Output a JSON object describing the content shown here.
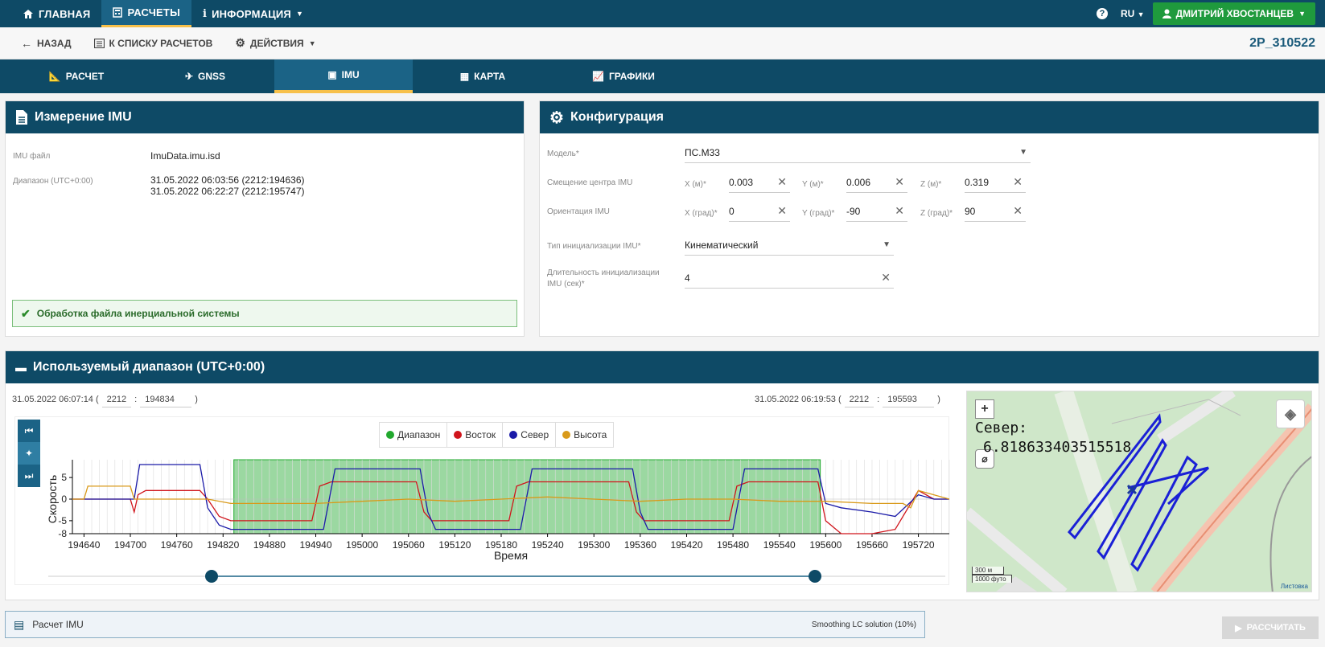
{
  "topnav": {
    "home_label": "ГЛАВНАЯ",
    "calc_label": "РАСЧЕТЫ",
    "info_label": "ИНФОРМАЦИЯ",
    "lang": "RU",
    "user": "ДМИТРИЙ ХВОСТАНЦЕВ"
  },
  "actions": {
    "back": "НАЗАД",
    "to_list": "К СПИСКУ РАСЧЕТОВ",
    "actions": "ДЕЙСТВИЯ",
    "code": "2P_310522"
  },
  "tabs": [
    {
      "label": "РАСЧЕТ"
    },
    {
      "label": "GNSS"
    },
    {
      "label": "IMU"
    },
    {
      "label": "КАРТА"
    },
    {
      "label": "ГРАФИКИ"
    }
  ],
  "imu_panel": {
    "title": "Измерение IMU",
    "file_label": "IMU файл",
    "file_value": "ImuData.imu.isd",
    "range_label": "Диапазон (UTC+0:00)",
    "range_start": "31.05.2022 06:03:56 (2212:194636)",
    "range_end": "31.05.2022 06:22:27 (2212:195747)",
    "success": "Обработка файла инерциальной системы"
  },
  "config_panel": {
    "title": "Конфигурация",
    "model_label": "Модель*",
    "model_value": "ПС.М33",
    "offset_label": "Смещение центра IMU",
    "offset_x_label": "X (м)*",
    "offset_x": "0.003",
    "offset_y_label": "Y (м)*",
    "offset_y": "0.006",
    "offset_z_label": "Z (м)*",
    "offset_z": "0.319",
    "orient_label": "Ориентация IMU",
    "orient_x_label": "X (град)*",
    "orient_x": "0",
    "orient_y_label": "Y (град)*",
    "orient_y": "-90",
    "orient_z_label": "Z (град)*",
    "orient_z": "90",
    "init_type_label": "Тип инициализации IMU*",
    "init_type_value": "Кинематический",
    "init_dur_label_1": "Длительность инициализации",
    "init_dur_label_2": "IMU (сек)*",
    "init_dur_value": "4"
  },
  "range_panel": {
    "title": "Используемый диапазон (UTC+0:00)",
    "start_time": "31.05.2022 06:07:14 (",
    "start_week": "2212",
    "start_sep": ":",
    "start_sec": "194834",
    "start_close": ")",
    "end_time": "31.05.2022 06:19:53 (",
    "end_week": "2212",
    "end_sep": ":",
    "end_sec": "195593",
    "end_close": ")"
  },
  "chart_data": {
    "type": "line",
    "xlabel": "Время",
    "ylabel": "Скорость",
    "xlim": [
      194625,
      195760
    ],
    "ylim": [
      -8,
      8
    ],
    "x_ticks": [
      194640,
      194700,
      194760,
      194820,
      194880,
      194940,
      195000,
      195060,
      195120,
      195180,
      195240,
      195300,
      195360,
      195420,
      195480,
      195540,
      195600,
      195660,
      195720
    ],
    "y_ticks": [
      -8,
      -5,
      0,
      5
    ],
    "legend": [
      "Диапазон",
      "Восток",
      "Север",
      "Высота"
    ],
    "range": [
      194834,
      195593
    ],
    "colors": {
      "range": "#22a82e",
      "east": "#d0141b",
      "north": "#1a1aa8",
      "height": "#d99a1a"
    },
    "series": [
      {
        "name": "Восток",
        "x": [
          194625,
          194700,
          194705,
          194710,
          194720,
          194730,
          194740,
          194790,
          194800,
          194815,
          194830,
          194845,
          194935,
          194945,
          194960,
          195070,
          195080,
          195090,
          195190,
          195200,
          195215,
          195345,
          195355,
          195365,
          195475,
          195485,
          195500,
          195590,
          195600,
          195620,
          195660,
          195690,
          195720,
          195740,
          195760
        ],
        "values": [
          0,
          0,
          -3,
          1,
          2,
          2,
          2,
          2,
          0,
          -4,
          -5,
          -5,
          -5,
          3,
          4,
          4,
          -3,
          -5,
          -5,
          3,
          4,
          4,
          -3,
          -5,
          -5,
          3,
          4,
          4,
          -5,
          -8,
          -8,
          -7,
          2,
          0,
          0
        ]
      },
      {
        "name": "Север",
        "x": [
          194625,
          194700,
          194705,
          194712,
          194720,
          194730,
          194790,
          194800,
          194815,
          194830,
          194950,
          194965,
          195075,
          195085,
          195095,
          195205,
          195220,
          195350,
          195360,
          195370,
          195480,
          195495,
          195590,
          195600,
          195620,
          195660,
          195690,
          195720,
          195740,
          195760
        ],
        "values": [
          0,
          0,
          0,
          8,
          8,
          8,
          8,
          -2,
          -6,
          -7,
          -7,
          7,
          7,
          -3,
          -7,
          -7,
          7,
          7,
          -3,
          -7,
          -7,
          7,
          7,
          -1,
          -2,
          -3,
          -4,
          1,
          0,
          0
        ]
      },
      {
        "name": "Высота",
        "x": [
          194625,
          194640,
          194645,
          194660,
          194680,
          194700,
          194705,
          194800,
          194830,
          194940,
          195000,
          195060,
          195120,
          195180,
          195240,
          195300,
          195360,
          195420,
          195480,
          195540,
          195600,
          195660,
          195700,
          195710,
          195720,
          195760
        ],
        "values": [
          0,
          0,
          3,
          3,
          3,
          3,
          0,
          0,
          -1,
          -1,
          -0.5,
          0,
          -0.5,
          0,
          0.5,
          0,
          -0.5,
          0,
          0,
          -0.5,
          -0.5,
          -1,
          -1,
          -2,
          2,
          0
        ]
      }
    ]
  },
  "map": {
    "coord_label": "Север:",
    "coord_value": "6.818633403515518",
    "scale_m": "300 м",
    "scale_ft": "1000 футо",
    "attribution": "Листовка"
  },
  "bottom": {
    "label": "Расчет IMU",
    "status": "Smoothing LC solution (10%)",
    "calc_button": "РАССЧИТАТЬ"
  }
}
